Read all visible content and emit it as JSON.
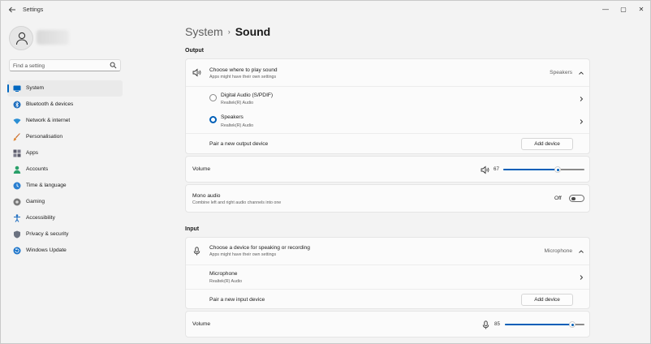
{
  "window": {
    "title": "Settings",
    "back_icon": "back-arrow-icon",
    "minimize_glyph": "—",
    "maximize_glyph": "▢",
    "close_glyph": "✕"
  },
  "sidebar": {
    "search_placeholder": "Find a setting",
    "items": [
      {
        "label": "System",
        "icon": "system-icon",
        "active": true,
        "color": "#0067c0"
      },
      {
        "label": "Bluetooth & devices",
        "icon": "bluetooth-icon",
        "color": "#1f6fbf"
      },
      {
        "label": "Network & internet",
        "icon": "network-icon",
        "color": "#2b8fd4"
      },
      {
        "label": "Personalisation",
        "icon": "paintbrush-icon",
        "color": "#c96a2a"
      },
      {
        "label": "Apps",
        "icon": "apps-icon",
        "color": "#5a5a6a"
      },
      {
        "label": "Accounts",
        "icon": "accounts-icon",
        "color": "#2aa06a"
      },
      {
        "label": "Time & language",
        "icon": "globe-clock-icon",
        "color": "#2a7fd0"
      },
      {
        "label": "Gaming",
        "icon": "gaming-icon",
        "color": "#6a6a6a"
      },
      {
        "label": "Accessibility",
        "icon": "accessibility-icon",
        "color": "#1c6cc0"
      },
      {
        "label": "Privacy & security",
        "icon": "shield-icon",
        "color": "#6b7280"
      },
      {
        "label": "Windows Update",
        "icon": "windows-update-icon",
        "color": "#1a73c9"
      }
    ]
  },
  "breadcrumb": {
    "parent": "System",
    "separator": "›",
    "current": "Sound"
  },
  "output": {
    "section_label": "Output",
    "choose": {
      "title": "Choose where to play sound",
      "subtitle": "Apps might have their own settings",
      "value": "Speakers"
    },
    "devices": [
      {
        "name": "Digital Audio (S/PDIF)",
        "driver": "Realtek(R) Audio",
        "selected": false
      },
      {
        "name": "Speakers",
        "driver": "Realtek(R) Audio",
        "selected": true
      }
    ],
    "pair": {
      "label": "Pair a new output device",
      "button": "Add device"
    },
    "volume": {
      "label": "Volume",
      "value": "67",
      "level": 0.67
    },
    "mono": {
      "title": "Mono audio",
      "subtitle": "Combine left and right audio channels into one",
      "state": "Off"
    }
  },
  "input": {
    "section_label": "Input",
    "choose": {
      "title": "Choose a device for speaking or recording",
      "subtitle": "Apps might have their own settings",
      "value": "Microphone"
    },
    "devices": [
      {
        "name": "Microphone",
        "driver": "Realtek(R) Audio"
      }
    ],
    "pair": {
      "label": "Pair a new input device",
      "button": "Add device"
    },
    "volume": {
      "label": "Volume",
      "value": "85",
      "level": 0.85
    }
  },
  "colors": {
    "accent": "#005fb8",
    "background": "#f3f3f3",
    "card": "#fbfbfb"
  }
}
